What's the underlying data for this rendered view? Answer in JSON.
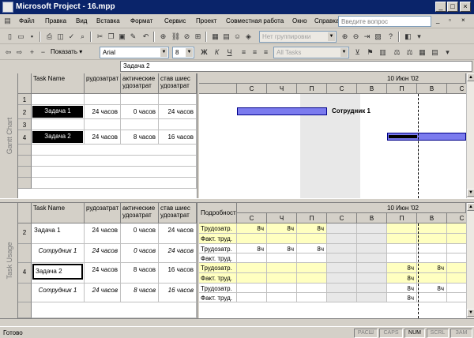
{
  "window": {
    "title": "Microsoft Project - 16.mpp"
  },
  "menu": {
    "items": [
      "Файл",
      "Правка",
      "Вид",
      "Вставка",
      "Формат",
      "Сервис",
      "Проект",
      "Совместная работа",
      "Окно",
      "Справка"
    ],
    "help_placeholder": "Введите вопрос"
  },
  "toolbar": {
    "grouping": "Нет группировки",
    "show_label": "Показать",
    "font": "Arial",
    "font_size": "8",
    "bold": "Ж",
    "italic": "К",
    "underline": "Ч",
    "filter": "All Tasks"
  },
  "entry_bar": {
    "value": "Задача 2"
  },
  "gantt": {
    "side_label": "Gantt Chart",
    "columns": [
      "",
      "Task Name",
      "Трудозатраты",
      "Фактические трудозатраты",
      "Оставшиеся трудозатраты"
    ],
    "column_display": [
      "",
      "Task Name",
      "рудозатрат",
      "актические\nудозатрат",
      "став шиес\nудозатрат"
    ],
    "rows": [
      {
        "id": "1",
        "name": "",
        "work": "",
        "actual": "",
        "remaining": ""
      },
      {
        "id": "2",
        "name": "Задача 1",
        "work": "24 часов",
        "actual": "0 часов",
        "remaining": "24 часов"
      },
      {
        "id": "3",
        "name": "",
        "work": "",
        "actual": "",
        "remaining": ""
      },
      {
        "id": "4",
        "name": "Задача 2",
        "work": "24 часов",
        "actual": "8 часов",
        "remaining": "16 часов"
      }
    ],
    "timescale_major": "10 Июн '02",
    "days": [
      "С",
      "Ч",
      "П",
      "С",
      "В",
      "П",
      "В",
      "С"
    ],
    "bar_label": "Сотрудник 1"
  },
  "usage": {
    "side_label": "Task Usage",
    "columns": [
      "",
      "Task Name",
      "рудозатрат",
      "актические\nудозатрат",
      "став шиес\nудозатрат"
    ],
    "detail_header": "Подробност",
    "rows": [
      {
        "id": "2",
        "name": "Задача 1",
        "work": "24 часов",
        "actual": "0 часов",
        "remaining": "24 часов",
        "italic": false
      },
      {
        "id": "",
        "name": "Сотрудник 1",
        "work": "24 часов",
        "actual": "0 часов",
        "remaining": "24 часов",
        "italic": true
      },
      {
        "id": "4",
        "name": "Задача 2",
        "work": "24 часов",
        "actual": "8 часов",
        "remaining": "16 часов",
        "italic": false
      },
      {
        "id": "",
        "name": "Сотрудник 1",
        "work": "24 часов",
        "actual": "8 часов",
        "remaining": "16 часов",
        "italic": true
      }
    ],
    "detail_labels": [
      "Трудозатр.",
      "Факт. труд.",
      "Трудозатр.",
      "Факт. труд.",
      "Трудозатр.",
      "Факт. труд.",
      "Трудозатр.",
      "Факт. труд."
    ],
    "timescale_major": "10 Июн '02",
    "days": [
      "С",
      "Ч",
      "П",
      "С",
      "В",
      "П",
      "В",
      "С"
    ],
    "values": [
      [
        "8ч",
        "8ч",
        "8ч",
        "",
        "",
        "",
        "",
        ""
      ],
      [
        "",
        "",
        "",
        "",
        "",
        "",
        "",
        ""
      ],
      [
        "8ч",
        "8ч",
        "8ч",
        "",
        "",
        "",
        "",
        ""
      ],
      [
        "",
        "",
        "",
        "",
        "",
        "",
        "",
        ""
      ],
      [
        "",
        "",
        "",
        "",
        "",
        "8ч",
        "8ч",
        ""
      ],
      [
        "",
        "",
        "",
        "",
        "",
        "8ч",
        "",
        ""
      ],
      [
        "",
        "",
        "",
        "",
        "",
        "8ч",
        "8ч",
        ""
      ],
      [
        "",
        "",
        "",
        "",
        "",
        "8ч",
        "",
        ""
      ]
    ]
  },
  "status": {
    "ready": "Готово",
    "indicators": [
      "РАСШ",
      "CAPS",
      "NUM",
      "SCRL",
      "ЗАМ"
    ]
  },
  "colors": {
    "bar": "#7b7bee",
    "highlight_row": "#ffffc0",
    "title_bar": "#0a246a"
  }
}
